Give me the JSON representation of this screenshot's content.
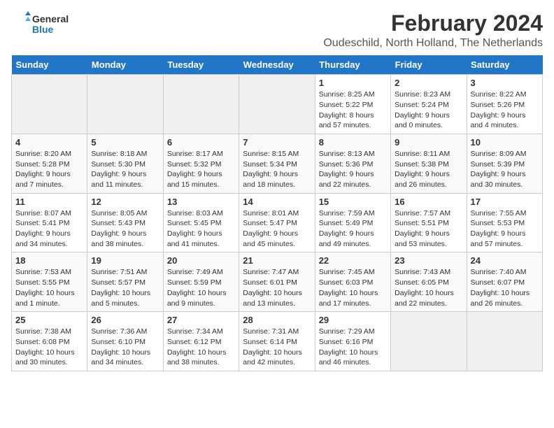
{
  "logo": {
    "text_general": "General",
    "text_blue": "Blue"
  },
  "title": "February 2024",
  "subtitle": "Oudeschild, North Holland, The Netherlands",
  "weekdays": [
    "Sunday",
    "Monday",
    "Tuesday",
    "Wednesday",
    "Thursday",
    "Friday",
    "Saturday"
  ],
  "weeks": [
    [
      {
        "day": "",
        "info": ""
      },
      {
        "day": "",
        "info": ""
      },
      {
        "day": "",
        "info": ""
      },
      {
        "day": "",
        "info": ""
      },
      {
        "day": "1",
        "info": "Sunrise: 8:25 AM\nSunset: 5:22 PM\nDaylight: 8 hours and 57 minutes."
      },
      {
        "day": "2",
        "info": "Sunrise: 8:23 AM\nSunset: 5:24 PM\nDaylight: 9 hours and 0 minutes."
      },
      {
        "day": "3",
        "info": "Sunrise: 8:22 AM\nSunset: 5:26 PM\nDaylight: 9 hours and 4 minutes."
      }
    ],
    [
      {
        "day": "4",
        "info": "Sunrise: 8:20 AM\nSunset: 5:28 PM\nDaylight: 9 hours and 7 minutes."
      },
      {
        "day": "5",
        "info": "Sunrise: 8:18 AM\nSunset: 5:30 PM\nDaylight: 9 hours and 11 minutes."
      },
      {
        "day": "6",
        "info": "Sunrise: 8:17 AM\nSunset: 5:32 PM\nDaylight: 9 hours and 15 minutes."
      },
      {
        "day": "7",
        "info": "Sunrise: 8:15 AM\nSunset: 5:34 PM\nDaylight: 9 hours and 18 minutes."
      },
      {
        "day": "8",
        "info": "Sunrise: 8:13 AM\nSunset: 5:36 PM\nDaylight: 9 hours and 22 minutes."
      },
      {
        "day": "9",
        "info": "Sunrise: 8:11 AM\nSunset: 5:38 PM\nDaylight: 9 hours and 26 minutes."
      },
      {
        "day": "10",
        "info": "Sunrise: 8:09 AM\nSunset: 5:39 PM\nDaylight: 9 hours and 30 minutes."
      }
    ],
    [
      {
        "day": "11",
        "info": "Sunrise: 8:07 AM\nSunset: 5:41 PM\nDaylight: 9 hours and 34 minutes."
      },
      {
        "day": "12",
        "info": "Sunrise: 8:05 AM\nSunset: 5:43 PM\nDaylight: 9 hours and 38 minutes."
      },
      {
        "day": "13",
        "info": "Sunrise: 8:03 AM\nSunset: 5:45 PM\nDaylight: 9 hours and 41 minutes."
      },
      {
        "day": "14",
        "info": "Sunrise: 8:01 AM\nSunset: 5:47 PM\nDaylight: 9 hours and 45 minutes."
      },
      {
        "day": "15",
        "info": "Sunrise: 7:59 AM\nSunset: 5:49 PM\nDaylight: 9 hours and 49 minutes."
      },
      {
        "day": "16",
        "info": "Sunrise: 7:57 AM\nSunset: 5:51 PM\nDaylight: 9 hours and 53 minutes."
      },
      {
        "day": "17",
        "info": "Sunrise: 7:55 AM\nSunset: 5:53 PM\nDaylight: 9 hours and 57 minutes."
      }
    ],
    [
      {
        "day": "18",
        "info": "Sunrise: 7:53 AM\nSunset: 5:55 PM\nDaylight: 10 hours and 1 minute."
      },
      {
        "day": "19",
        "info": "Sunrise: 7:51 AM\nSunset: 5:57 PM\nDaylight: 10 hours and 5 minutes."
      },
      {
        "day": "20",
        "info": "Sunrise: 7:49 AM\nSunset: 5:59 PM\nDaylight: 10 hours and 9 minutes."
      },
      {
        "day": "21",
        "info": "Sunrise: 7:47 AM\nSunset: 6:01 PM\nDaylight: 10 hours and 13 minutes."
      },
      {
        "day": "22",
        "info": "Sunrise: 7:45 AM\nSunset: 6:03 PM\nDaylight: 10 hours and 17 minutes."
      },
      {
        "day": "23",
        "info": "Sunrise: 7:43 AM\nSunset: 6:05 PM\nDaylight: 10 hours and 22 minutes."
      },
      {
        "day": "24",
        "info": "Sunrise: 7:40 AM\nSunset: 6:07 PM\nDaylight: 10 hours and 26 minutes."
      }
    ],
    [
      {
        "day": "25",
        "info": "Sunrise: 7:38 AM\nSunset: 6:08 PM\nDaylight: 10 hours and 30 minutes."
      },
      {
        "day": "26",
        "info": "Sunrise: 7:36 AM\nSunset: 6:10 PM\nDaylight: 10 hours and 34 minutes."
      },
      {
        "day": "27",
        "info": "Sunrise: 7:34 AM\nSunset: 6:12 PM\nDaylight: 10 hours and 38 minutes."
      },
      {
        "day": "28",
        "info": "Sunrise: 7:31 AM\nSunset: 6:14 PM\nDaylight: 10 hours and 42 minutes."
      },
      {
        "day": "29",
        "info": "Sunrise: 7:29 AM\nSunset: 6:16 PM\nDaylight: 10 hours and 46 minutes."
      },
      {
        "day": "",
        "info": ""
      },
      {
        "day": "",
        "info": ""
      }
    ]
  ]
}
